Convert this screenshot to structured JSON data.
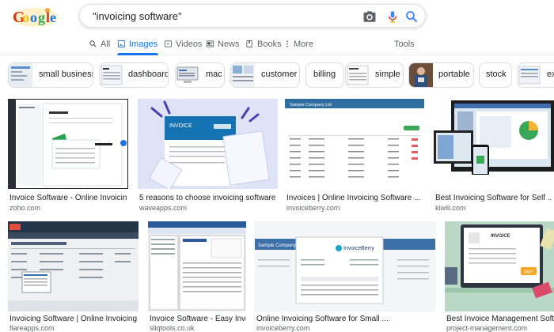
{
  "logo": {
    "alt": "Google"
  },
  "search": {
    "query": "\"invoicing software\""
  },
  "tabs": [
    {
      "label": "All",
      "icon": "search-icon"
    },
    {
      "label": "Images",
      "icon": "image-icon",
      "active": true
    },
    {
      "label": "Videos",
      "icon": "play-icon"
    },
    {
      "label": "News",
      "icon": "news-icon"
    },
    {
      "label": "Books",
      "icon": "book-icon"
    },
    {
      "label": "More",
      "icon": "more-vertical-icon"
    }
  ],
  "tools_label": "Tools",
  "chips": [
    {
      "label": "small business"
    },
    {
      "label": "dashboard"
    },
    {
      "label": "mac"
    },
    {
      "label": "customer"
    },
    {
      "label": "billing"
    },
    {
      "label": "simple"
    },
    {
      "label": "portable"
    },
    {
      "label": "stock"
    },
    {
      "label": "ex"
    }
  ],
  "results": [
    {
      "title": "Invoice Software - Online Invoicing for ...",
      "source": "zoho.com"
    },
    {
      "title": "5 reasons to choose invoicing software ...",
      "source": "waveapps.com"
    },
    {
      "title": "Invoices | Online Invoicing Software ...",
      "source": "invoiceberry.com"
    },
    {
      "title": "Best Invoicing Software for Self ...",
      "source": "kiwili.com"
    },
    {
      "title": "Invoicing Software | Online Invoicing ...",
      "source": "flareapps.com"
    },
    {
      "title": "Invoice Software - Easy Invoicin...",
      "source": "sliqtools.co.uk"
    },
    {
      "title": "Online Invoicing Software for Small ...",
      "source": "invoiceberry.com"
    },
    {
      "title": "Best Invoice Management Software fo...",
      "source": "project-management.com"
    }
  ],
  "image_text": {
    "invoice": "INVOICE",
    "invoice_berry": "InvoiceBerry",
    "pay": "PAY",
    "sample_company": "Sample Company Ltd"
  },
  "colors": {
    "accent": "#1a73e8",
    "border": "#dfe1e5",
    "muted": "#5f6368"
  }
}
